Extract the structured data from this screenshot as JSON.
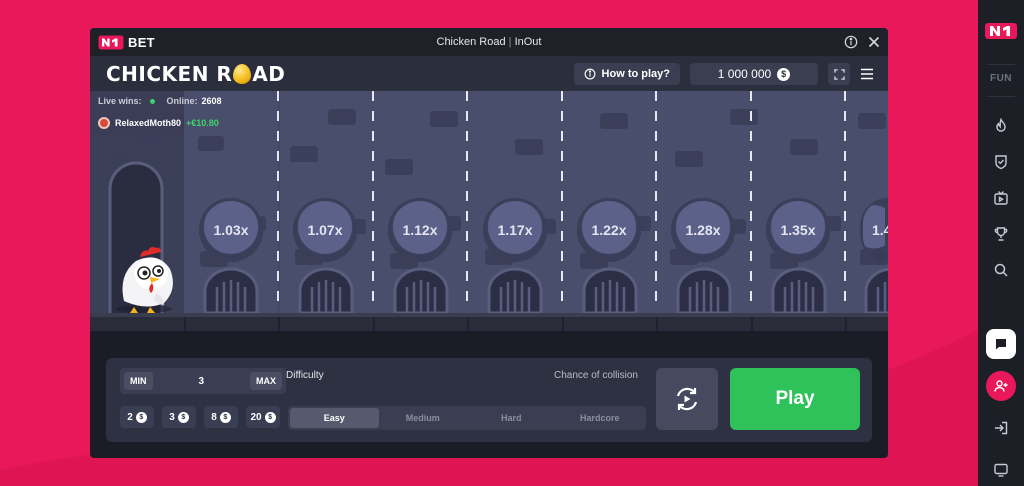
{
  "window": {
    "brand": "BET",
    "title": "Chicken Road",
    "title_separator": "|",
    "provider": "InOut"
  },
  "header": {
    "game_title_pre": "CHICKEN R",
    "game_title_post": "AD",
    "how_to_play": "How to play?",
    "balance": "1 000 000",
    "currency_symbol": "$"
  },
  "live": {
    "label": "Live wins:",
    "online_label": "Online:",
    "online_count": "2608",
    "winner_name": "RelaxedMoth80",
    "winner_amount": "+€10.80"
  },
  "multipliers": [
    "1.03x",
    "1.07x",
    "1.12x",
    "1.17x",
    "1.22x",
    "1.28x",
    "1.35x",
    "1.4"
  ],
  "controls": {
    "min_label": "MIN",
    "max_label": "MAX",
    "bet_value": "3",
    "chips": [
      "2",
      "3",
      "8",
      "20"
    ],
    "difficulty_label": "Difficulty",
    "chance_label": "Chance of collision",
    "difficulties": [
      "Easy",
      "Medium",
      "Hard",
      "Hardcore"
    ],
    "active_difficulty": "Easy",
    "play_label": "Play"
  },
  "sidebar": {
    "mode": "FUN"
  },
  "colors": {
    "background": "#e8185a",
    "accent_green": "#2fc25a",
    "sidebar": "#1c1f26"
  }
}
